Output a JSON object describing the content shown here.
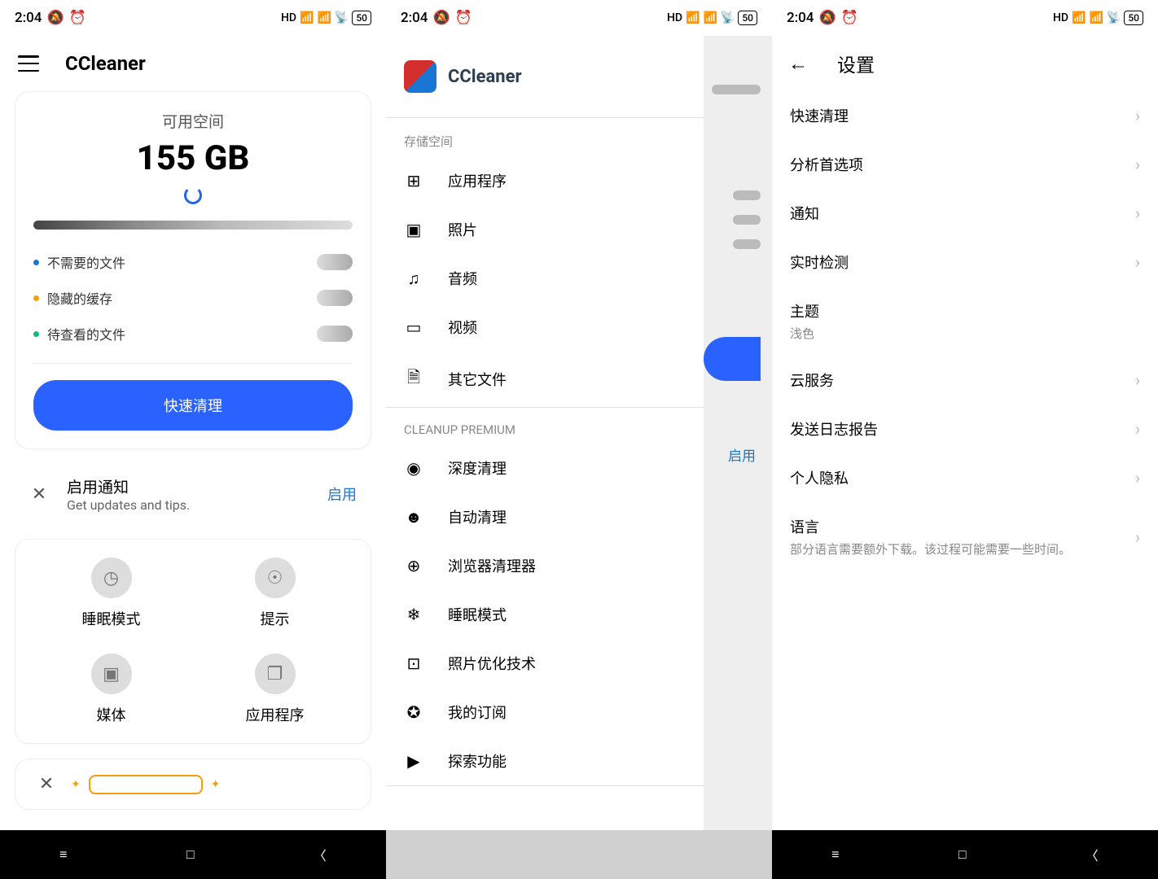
{
  "status": {
    "time": "2:04",
    "hd": "HD",
    "battery": "50"
  },
  "p1": {
    "app_title": "CCleaner",
    "space_label": "可用空间",
    "space_value": "155 GB",
    "legend": [
      {
        "color": "#1976d2",
        "label": "不需要的文件"
      },
      {
        "color": "#f59e0b",
        "label": "隐藏的缓存"
      },
      {
        "color": "#10b981",
        "label": "待查看的文件"
      }
    ],
    "clean_btn": "快速清理",
    "notif": {
      "title": "启用通知",
      "sub": "Get updates and tips.",
      "action": "启用"
    },
    "tiles": [
      {
        "icon": "◷",
        "label": "睡眠模式"
      },
      {
        "icon": "☉",
        "label": "提示"
      },
      {
        "icon": "▣",
        "label": "媒体"
      },
      {
        "icon": "❐",
        "label": "应用程序"
      }
    ]
  },
  "p2": {
    "brand": "CCleaner",
    "sections": [
      {
        "label": "存储空间",
        "items": [
          {
            "icon": "⊞",
            "label": "应用程序"
          },
          {
            "icon": "▣",
            "label": "照片"
          },
          {
            "icon": "♫",
            "label": "音频"
          },
          {
            "icon": "▭",
            "label": "视频"
          },
          {
            "icon": "🗎",
            "label": "其它文件"
          }
        ]
      },
      {
        "label": "CLEANUP PREMIUM",
        "items": [
          {
            "icon": "◉",
            "label": "深度清理"
          },
          {
            "icon": "☻",
            "label": "自动清理"
          },
          {
            "icon": "⊕",
            "label": "浏览器清理器"
          },
          {
            "icon": "❄",
            "label": "睡眠模式"
          },
          {
            "icon": "⊡",
            "label": "照片优化技术"
          },
          {
            "icon": "✪",
            "label": "我的订阅"
          },
          {
            "icon": "▶",
            "label": "探索功能"
          }
        ]
      }
    ],
    "bg_enable": "启用"
  },
  "p3": {
    "title": "设置",
    "items": [
      {
        "label": "快速清理",
        "chev": true
      },
      {
        "label": "分析首选项",
        "chev": true
      },
      {
        "label": "通知",
        "chev": true
      },
      {
        "label": "实时检测",
        "chev": true
      },
      {
        "label": "主题",
        "sub": "浅色",
        "chev": false
      },
      {
        "label": "云服务",
        "chev": true
      },
      {
        "label": "发送日志报告",
        "chev": true
      },
      {
        "label": "个人隐私",
        "chev": true
      },
      {
        "label": "语言",
        "sub": "部分语言需要额外下载。该过程可能需要一些时间。",
        "chev": true
      }
    ]
  }
}
